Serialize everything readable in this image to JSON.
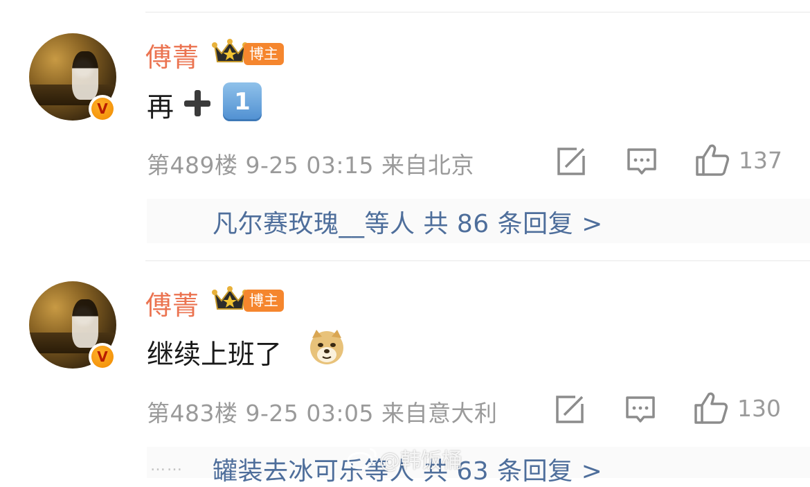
{
  "comments": [
    {
      "author": "傅菁",
      "tag": "博主",
      "verify_mark": "V",
      "text": "再",
      "emoji": [
        "heavy-plus-emoji",
        "keycap-1-emoji"
      ],
      "keycap": "1",
      "meta": "第489楼 9-25 03:15 来自北京",
      "likes": "137",
      "reply_summary": "凡尔赛玫瑰__等人  共 86 条回复 >"
    },
    {
      "author": "傅菁",
      "tag": "博主",
      "verify_mark": "V",
      "text": "继续上班了",
      "emoji": [
        "doge-emoji"
      ],
      "meta": "第483楼 9-25 03:05 来自意大利",
      "likes": "130",
      "reply_summary": "罐装去冰可乐等人  共 63 条回复 >",
      "reply_prefix": "……"
    }
  ],
  "watermark": "@韩饭桶",
  "colors": {
    "name": "#eb7350",
    "tag_bg": "#f5862e",
    "link": "#4e6e9b",
    "meta": "#9a9a9a"
  }
}
